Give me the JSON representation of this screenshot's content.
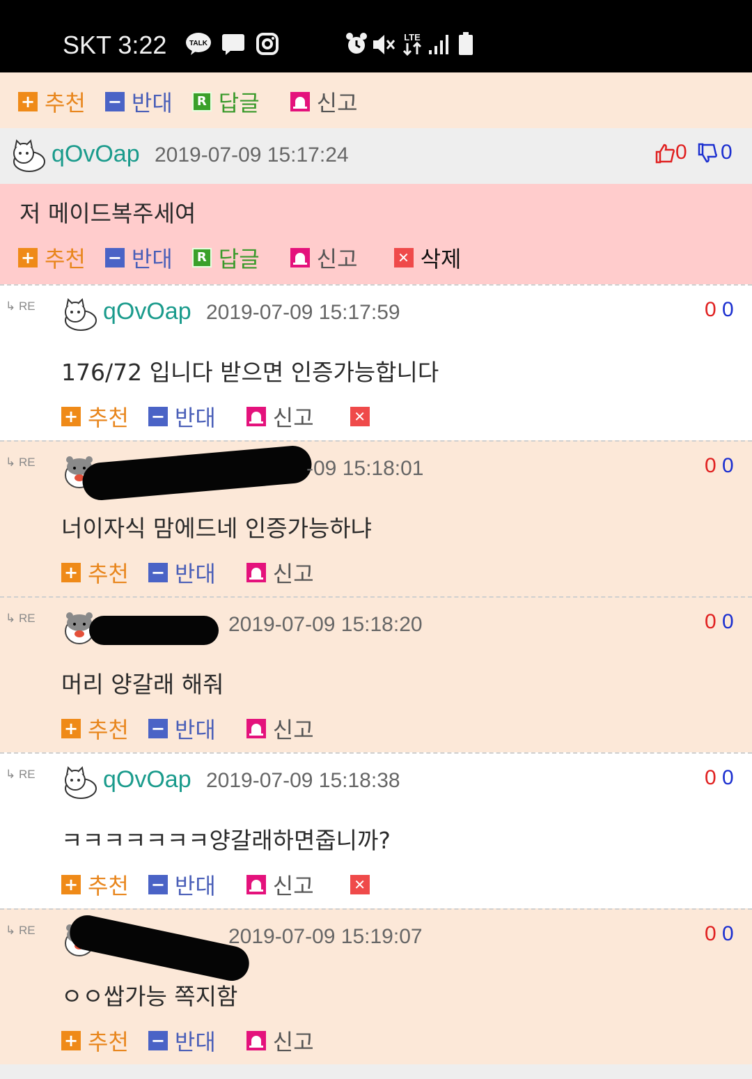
{
  "status_bar": {
    "carrier_time": "SKT 3:22",
    "network": "LTE"
  },
  "labels": {
    "recommend": "추천",
    "oppose": "반대",
    "reply": "답글",
    "report": "신고",
    "delete": "삭제",
    "re": "RE",
    "plus": "+",
    "minus": "−",
    "reply_icon": "R",
    "del_icon": "✕"
  },
  "main_comment": {
    "nick": "qOvOap",
    "date": "2019-07-09 15:17:24",
    "up": "0",
    "down": "0",
    "text": "저 메이드복주세여"
  },
  "replies": [
    {
      "nick": "qOvOap",
      "date": "2019-07-09 15:17:59",
      "up": "0",
      "down": "0",
      "text": "176/72 입니다 받으면 인증가능합니다"
    },
    {
      "nick": "",
      "date": "-09 15:18:01",
      "up": "0",
      "down": "0",
      "text": "너이자식 맘에드네 인증가능하냐"
    },
    {
      "nick": "",
      "date": "2019-07-09 15:18:20",
      "up": "0",
      "down": "0",
      "text": "머리 양갈래 해줘"
    },
    {
      "nick": "qOvOap",
      "date": "2019-07-09 15:18:38",
      "up": "0",
      "down": "0",
      "text": "ㅋㅋㅋㅋㅋㅋㅋ양갈래하면줍니까?"
    },
    {
      "nick": "",
      "date": "2019-07-09 15:19:07",
      "up": "0",
      "down": "0",
      "text": "ㅇㅇ쌉가능 쪽지함"
    }
  ],
  "colors": {
    "nick": "#1a9b8c",
    "upvote": "#e02020",
    "downvote": "#1b2fd0",
    "main_body_bg": "#ffcccc",
    "peach_bg": "#fce8d8"
  }
}
